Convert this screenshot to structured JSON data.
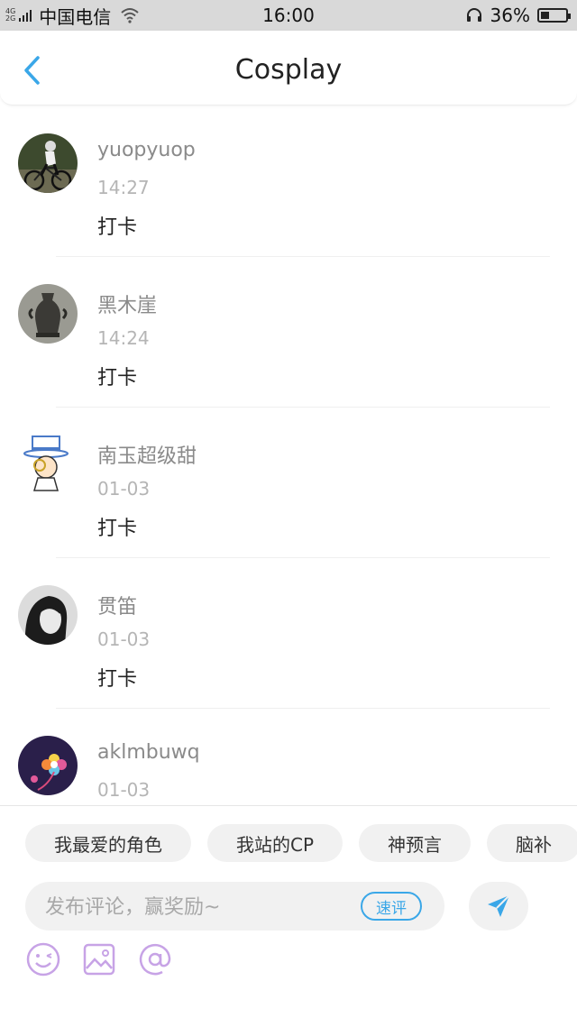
{
  "status_bar": {
    "network_top": "4G",
    "network_bottom": "2G",
    "carrier": "中国电信",
    "time": "16:00",
    "battery_text": "36%",
    "battery_level": 0.36
  },
  "header": {
    "back_icon": "chevron-left-icon",
    "title": "Cosplay",
    "accent_color": "#3aa7e8"
  },
  "comments": [
    {
      "user": "yuopyuop",
      "time": "14:27",
      "content": "打卡",
      "avatar": "cyclist-avatar"
    },
    {
      "user": "黑木崖",
      "time": "14:24",
      "content": "打卡",
      "avatar": "vase-avatar"
    },
    {
      "user": "南玉超级甜",
      "time": "01-03",
      "content": "打卡",
      "avatar": "cartoon-detective-avatar"
    },
    {
      "user": "贯笛",
      "time": "01-03",
      "content": "打卡",
      "avatar": "portrait-girl-avatar"
    },
    {
      "user": "aklmbuwq",
      "time": "01-03",
      "content": "",
      "avatar": "colorful-flower-avatar"
    }
  ],
  "bottom_bar": {
    "chips": [
      "我最爱的角色",
      "我站的CP",
      "神预言",
      "脑补"
    ],
    "comment_placeholder": "发布评论，赢奖励~",
    "quick_review_label": "速评",
    "send_icon": "send-icon",
    "tool_icons": [
      "emoji-icon",
      "image-icon",
      "at-icon"
    ],
    "tool_color": "#c7a3e6"
  }
}
